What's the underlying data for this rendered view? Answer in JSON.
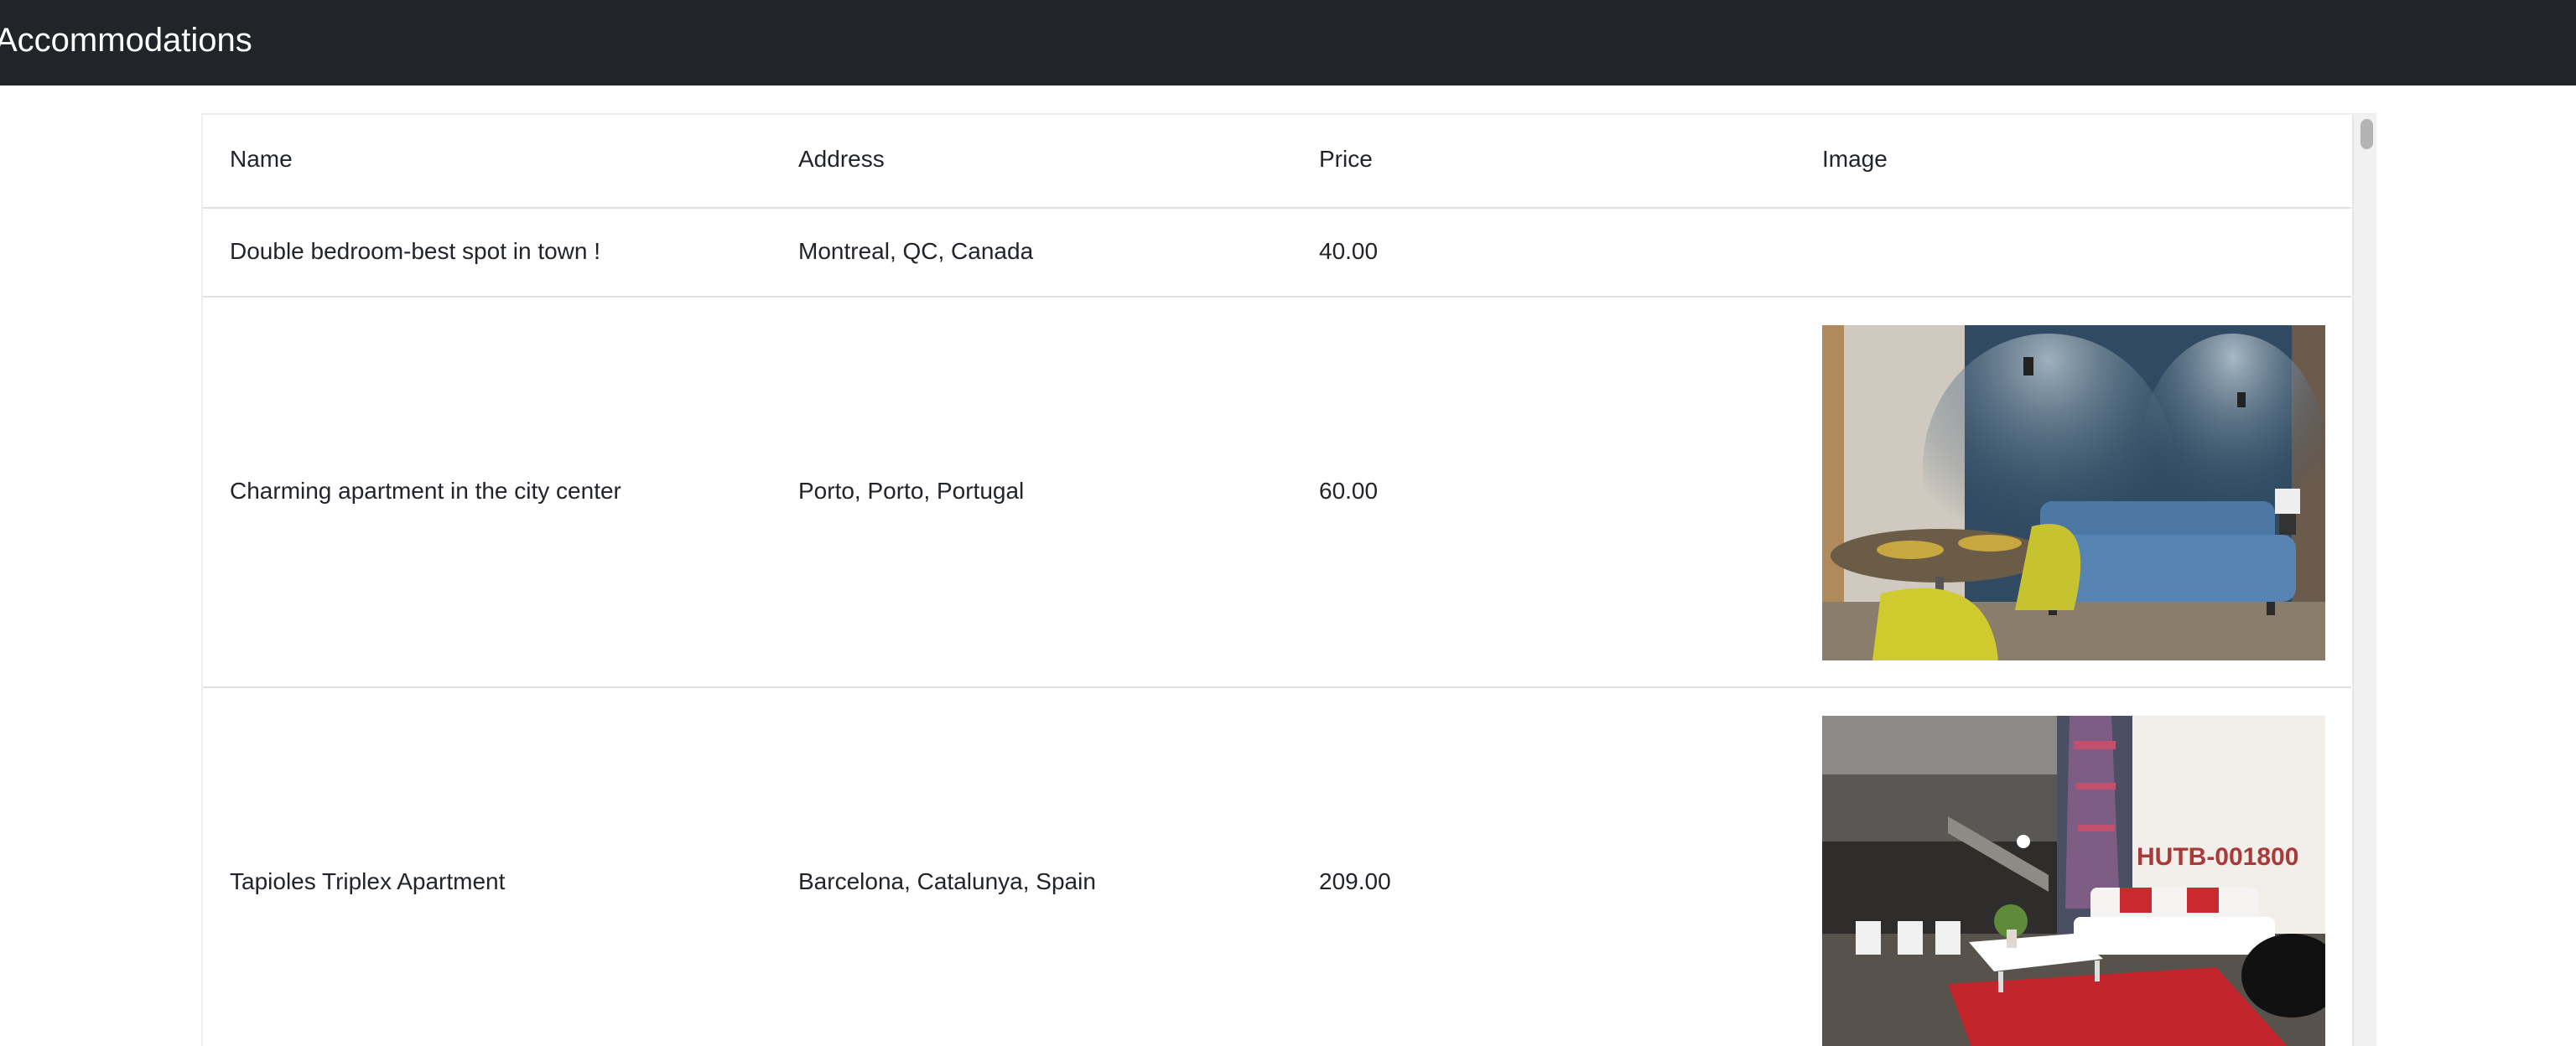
{
  "navbar": {
    "brand": "Accommodations"
  },
  "table": {
    "headers": {
      "name": "Name",
      "address": "Address",
      "price": "Price",
      "image": "Image"
    },
    "rows": [
      {
        "name": "Double bedroom-best spot in town !",
        "address": "Montreal, QC, Canada",
        "price": "40.00"
      },
      {
        "name": "Charming apartment in the city center",
        "address": "Porto, Porto, Portugal",
        "price": "60.00",
        "image": "living-room-photo"
      },
      {
        "name": "Tapioles Triplex Apartment",
        "address": "Barcelona, Catalunya, Spain",
        "price": "209.00",
        "image": "triplex-living-room-photo",
        "image_watermark": "HUTB-001800"
      }
    ]
  },
  "colors": {
    "navbar_bg": "#212529",
    "text": "#212529",
    "border": "#dee2e6"
  }
}
